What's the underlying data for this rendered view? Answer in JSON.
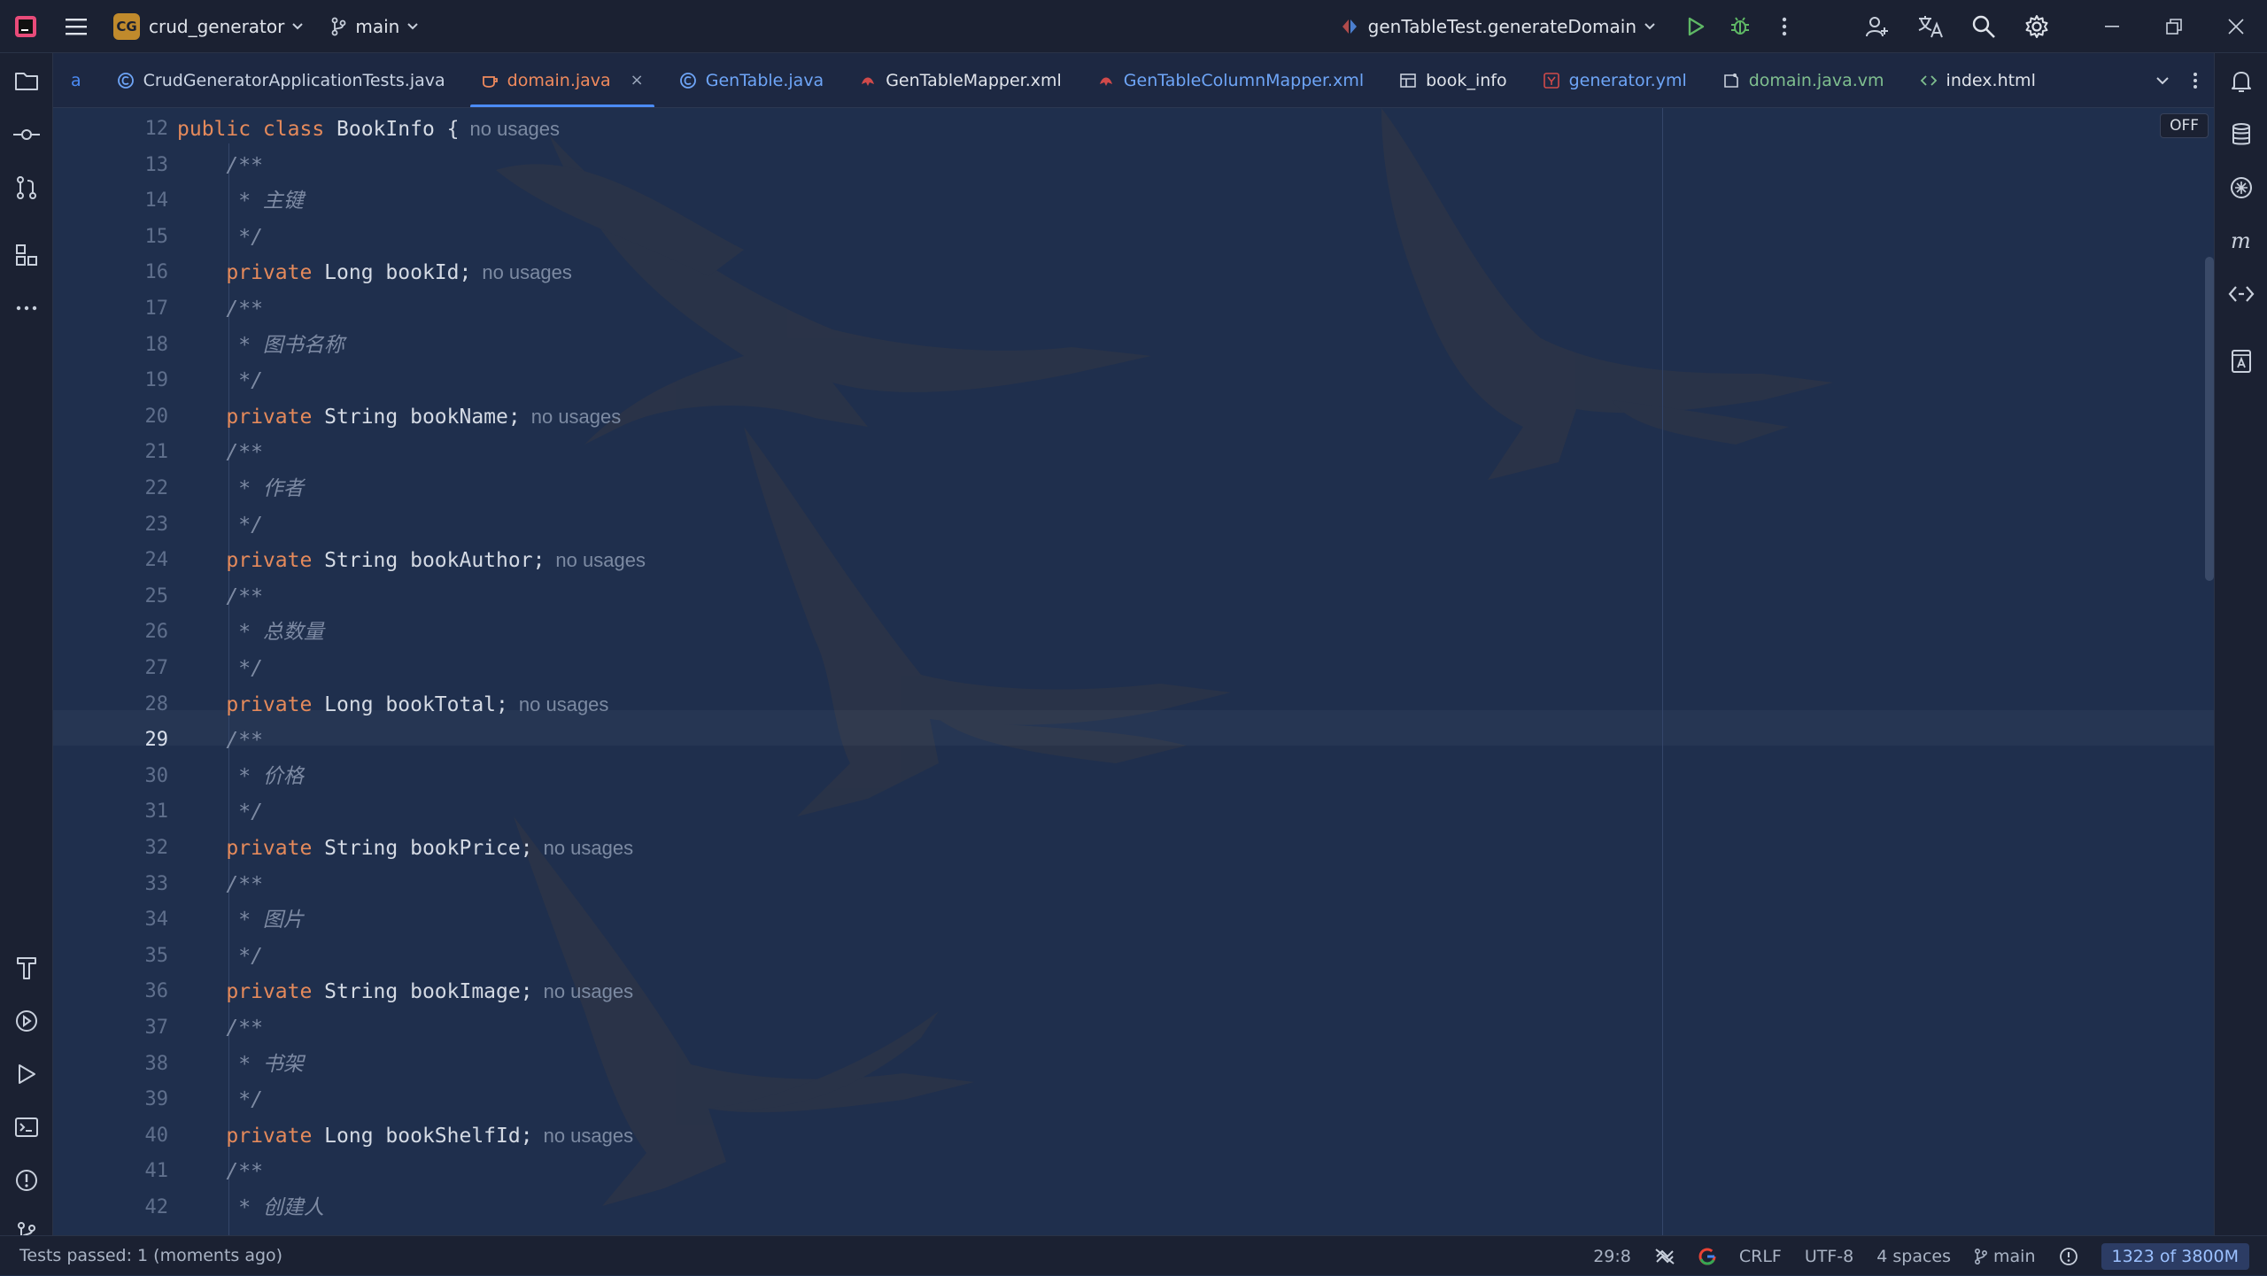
{
  "window": {
    "project_badge": "CG",
    "project_name": "crud_generator",
    "branch": "main",
    "run_config": "genTableTest.generateDomain"
  },
  "tabs": [
    {
      "label": "a",
      "icon": "truncated-tab",
      "color": "#4b8bf5"
    },
    {
      "label": "CrudGeneratorApplicationTests.java",
      "icon": "java-class-icon",
      "color": "#c9d3e3"
    },
    {
      "label": "domain.java",
      "icon": "java-file-icon",
      "color": "#f08a5d",
      "active": true
    },
    {
      "label": "GenTable.java",
      "icon": "java-class-icon",
      "color": "#6ea5f7"
    },
    {
      "label": "GenTableMapper.xml",
      "icon": "xml-mapper-icon",
      "color": "#dfe3ea"
    },
    {
      "label": "GenTableColumnMapper.xml",
      "icon": "xml-mapper-icon",
      "color": "#6ea5f7"
    },
    {
      "label": "book_info",
      "icon": "table-icon",
      "color": "#dfe3ea"
    },
    {
      "label": "generator.yml",
      "icon": "yaml-icon",
      "color": "#6ea5f7"
    },
    {
      "label": "domain.java.vm",
      "icon": "template-icon",
      "color": "#7fbf8f"
    },
    {
      "label": "index.html",
      "icon": "html-icon",
      "color": "#dfe3ea"
    }
  ],
  "editor": {
    "off_badge": "OFF",
    "current_line": 29,
    "lines": [
      {
        "n": "12",
        "parts": [
          {
            "t": "public class ",
            "c": "kw"
          },
          {
            "t": "BookInfo {",
            "c": ""
          }
        ],
        "hint": "no usages"
      },
      {
        "n": "13",
        "parts": [
          {
            "t": "    /**",
            "c": "cm"
          }
        ]
      },
      {
        "n": "14",
        "parts": [
          {
            "t": "     * 主键",
            "c": "cm"
          }
        ]
      },
      {
        "n": "15",
        "parts": [
          {
            "t": "     */",
            "c": "cm"
          }
        ]
      },
      {
        "n": "16",
        "parts": [
          {
            "t": "    private ",
            "c": "kw"
          },
          {
            "t": "Long bookId;",
            "c": ""
          }
        ],
        "hint": "no usages"
      },
      {
        "n": "17",
        "parts": [
          {
            "t": "    /**",
            "c": "cm"
          }
        ]
      },
      {
        "n": "18",
        "parts": [
          {
            "t": "     * 图书名称",
            "c": "cm"
          }
        ]
      },
      {
        "n": "19",
        "parts": [
          {
            "t": "     */",
            "c": "cm"
          }
        ]
      },
      {
        "n": "20",
        "parts": [
          {
            "t": "    private ",
            "c": "kw"
          },
          {
            "t": "String bookName;",
            "c": ""
          }
        ],
        "hint": "no usages"
      },
      {
        "n": "21",
        "parts": [
          {
            "t": "    /**",
            "c": "cm"
          }
        ]
      },
      {
        "n": "22",
        "parts": [
          {
            "t": "     * 作者",
            "c": "cm"
          }
        ]
      },
      {
        "n": "23",
        "parts": [
          {
            "t": "     */",
            "c": "cm"
          }
        ]
      },
      {
        "n": "24",
        "parts": [
          {
            "t": "    private ",
            "c": "kw"
          },
          {
            "t": "String bookAuthor;",
            "c": ""
          }
        ],
        "hint": "no usages"
      },
      {
        "n": "25",
        "parts": [
          {
            "t": "    /**",
            "c": "cm"
          }
        ]
      },
      {
        "n": "26",
        "parts": [
          {
            "t": "     * 总数量",
            "c": "cm"
          }
        ]
      },
      {
        "n": "27",
        "parts": [
          {
            "t": "     */",
            "c": "cm"
          }
        ]
      },
      {
        "n": "28",
        "parts": [
          {
            "t": "    private ",
            "c": "kw"
          },
          {
            "t": "Long bookTotal;",
            "c": ""
          }
        ],
        "hint": "no usages"
      },
      {
        "n": "29",
        "parts": [
          {
            "t": "    /**",
            "c": "cm"
          }
        ]
      },
      {
        "n": "30",
        "parts": [
          {
            "t": "     * 价格",
            "c": "cm"
          }
        ]
      },
      {
        "n": "31",
        "parts": [
          {
            "t": "     */",
            "c": "cm"
          }
        ]
      },
      {
        "n": "32",
        "parts": [
          {
            "t": "    private ",
            "c": "kw"
          },
          {
            "t": "String bookPrice;",
            "c": ""
          }
        ],
        "hint": "no usages"
      },
      {
        "n": "33",
        "parts": [
          {
            "t": "    /**",
            "c": "cm"
          }
        ]
      },
      {
        "n": "34",
        "parts": [
          {
            "t": "     * 图片",
            "c": "cm"
          }
        ]
      },
      {
        "n": "35",
        "parts": [
          {
            "t": "     */",
            "c": "cm"
          }
        ]
      },
      {
        "n": "36",
        "parts": [
          {
            "t": "    private ",
            "c": "kw"
          },
          {
            "t": "String bookImage;",
            "c": ""
          }
        ],
        "hint": "no usages"
      },
      {
        "n": "37",
        "parts": [
          {
            "t": "    /**",
            "c": "cm"
          }
        ]
      },
      {
        "n": "38",
        "parts": [
          {
            "t": "     * 书架",
            "c": "cm"
          }
        ]
      },
      {
        "n": "39",
        "parts": [
          {
            "t": "     */",
            "c": "cm"
          }
        ]
      },
      {
        "n": "40",
        "parts": [
          {
            "t": "    private ",
            "c": "kw"
          },
          {
            "t": "Long bookShelfId;",
            "c": ""
          }
        ],
        "hint": "no usages"
      },
      {
        "n": "41",
        "parts": [
          {
            "t": "    /**",
            "c": "cm"
          }
        ]
      },
      {
        "n": "42",
        "parts": [
          {
            "t": "     * 创建人",
            "c": "cm"
          }
        ]
      }
    ]
  },
  "statusbar": {
    "message": "Tests passed: 1 (moments ago)",
    "position": "29:8",
    "line_ending": "CRLF",
    "encoding": "UTF-8",
    "indent": "4 spaces",
    "branch": "main",
    "memory": "1323 of 3800M"
  },
  "colors": {
    "accent": "#4b8bf5",
    "keyword": "#e58a5b",
    "comment": "#7d8aa3",
    "run": "#5fb865"
  }
}
